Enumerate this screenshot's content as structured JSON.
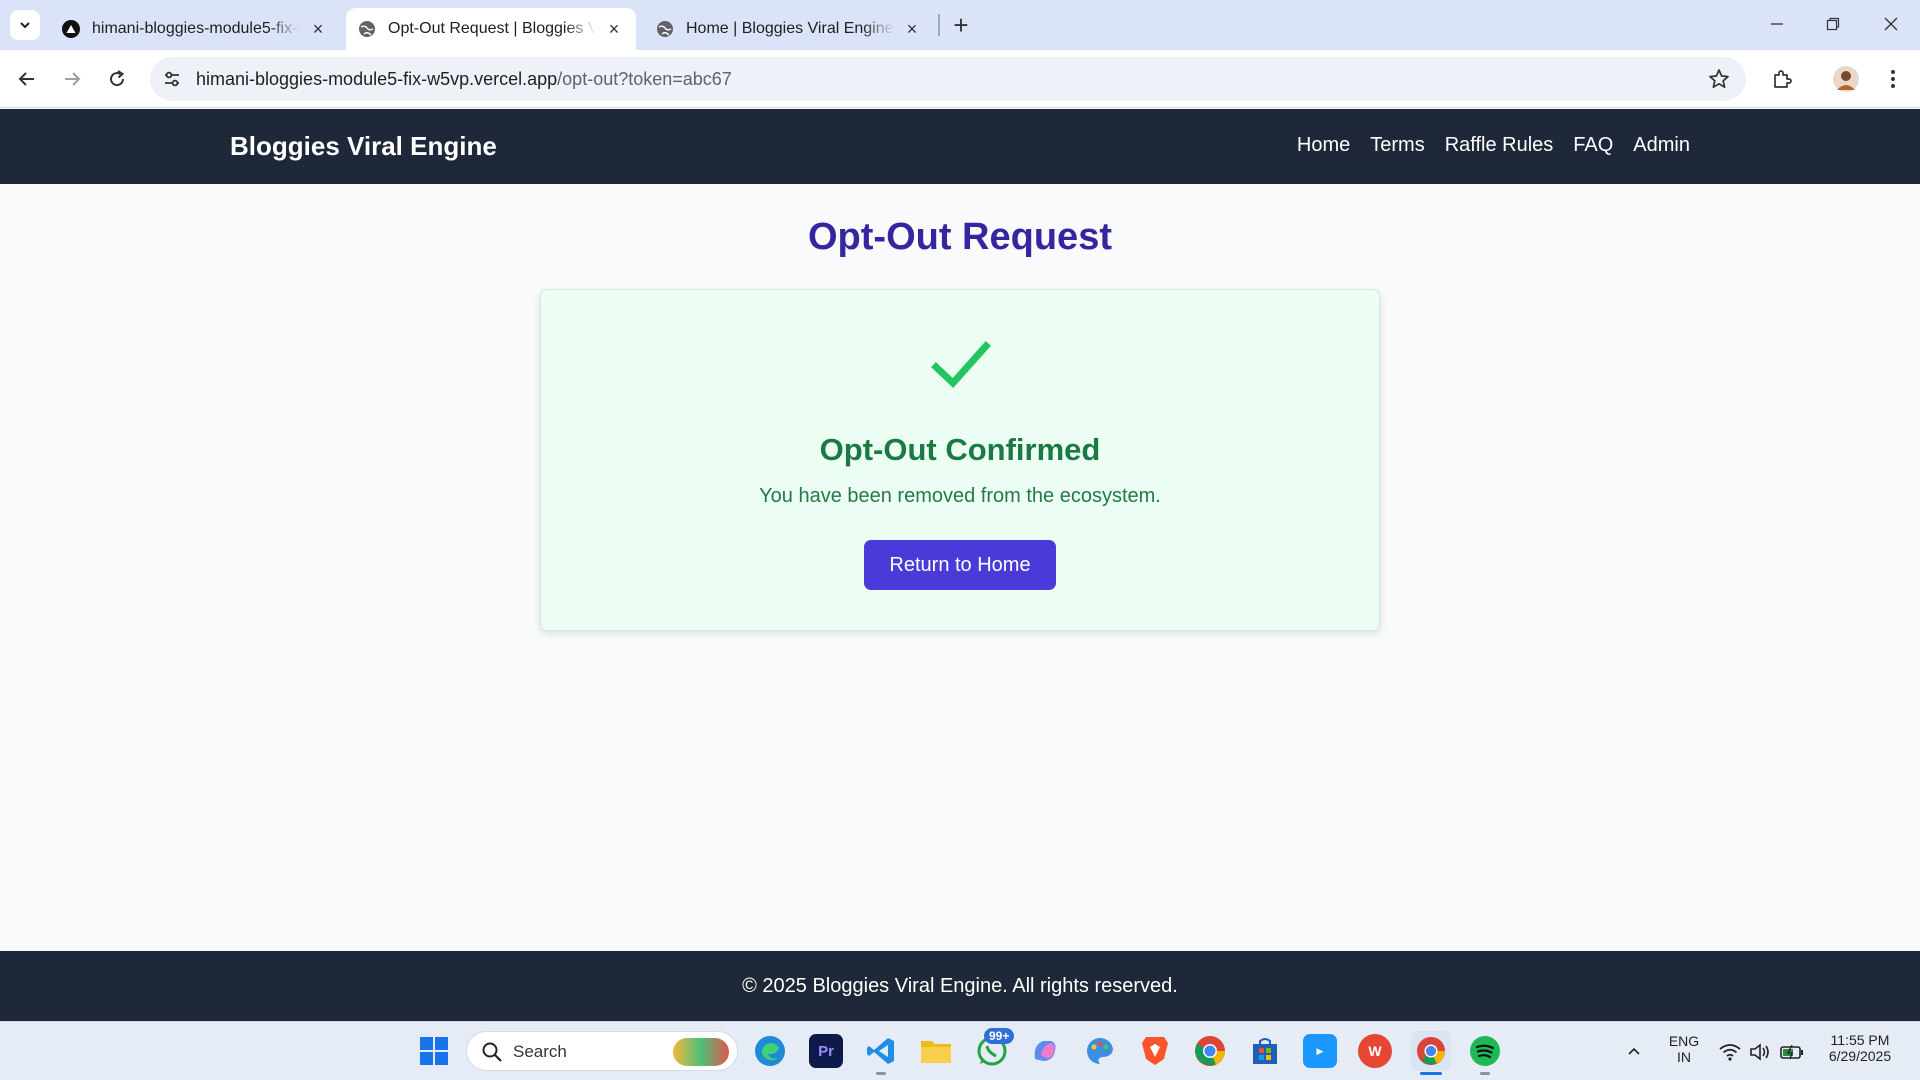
{
  "browser": {
    "tabs": [
      {
        "title": "himani-bloggies-module5-fix-w5vp",
        "active": false,
        "favicon": "vercel-icon"
      },
      {
        "title": "Opt-Out Request | Bloggies Viral Engine",
        "active": true,
        "favicon": "globe-icon"
      },
      {
        "title": "Home | Bloggies Viral Engine",
        "active": false,
        "favicon": "globe-icon"
      }
    ],
    "url_host": "himani-bloggies-module5-fix-w5vp.vercel.app",
    "url_path": "/opt-out?token=abc67"
  },
  "site": {
    "brand": "Bloggies Viral Engine",
    "nav": [
      "Home",
      "Terms",
      "Raffle Rules",
      "FAQ",
      "Admin"
    ]
  },
  "page": {
    "title": "Opt-Out Request",
    "confirmation": {
      "heading": "Opt-Out Confirmed",
      "message": "You have been removed from the ecosystem.",
      "button": "Return to Home"
    },
    "footer": "© 2025 Bloggies Viral Engine. All rights reserved."
  },
  "taskbar": {
    "search_placeholder": "Search",
    "whatsapp_badge": "99+",
    "lang_line1": "ENG",
    "lang_line2": "IN",
    "time": "11:55 PM",
    "date": "6/29/2025"
  },
  "colors": {
    "header_bg": "#1e2838",
    "title": "#3526a0",
    "success_green": "#1b7a43",
    "check_green": "#22c55e",
    "card_bg": "#ecfdf4",
    "button_bg": "#4a3bd9"
  }
}
